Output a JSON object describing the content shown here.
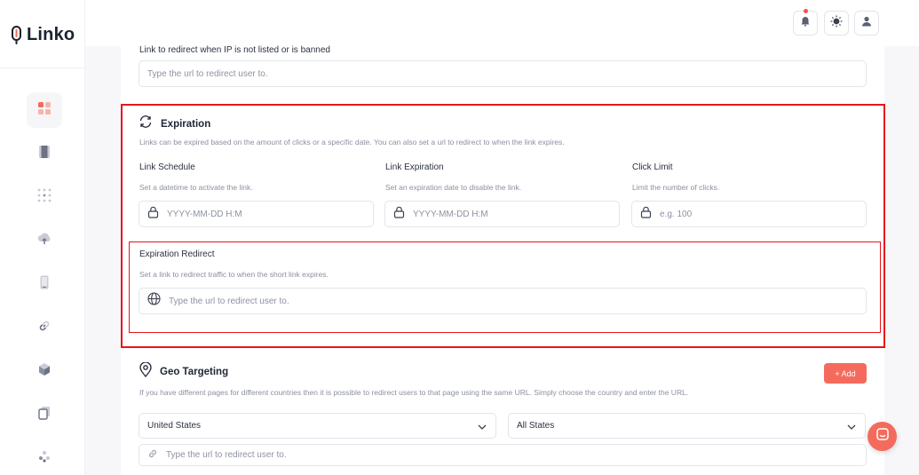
{
  "app": {
    "brand": "Linko"
  },
  "topbar": {
    "notification_icon": "bell-icon",
    "theme_icon": "sun-icon",
    "profile_icon": "user-icon"
  },
  "sidebar": {
    "items": [
      {
        "icon": "dashboard-grid-icon",
        "active": true
      },
      {
        "icon": "barcode-icon",
        "active": false
      },
      {
        "icon": "dots-grid-icon",
        "active": false
      },
      {
        "icon": "cloud-upload-icon",
        "active": false
      },
      {
        "icon": "mobile-icon",
        "active": false
      },
      {
        "icon": "link-icon",
        "active": false
      },
      {
        "icon": "cube-icon",
        "active": false
      },
      {
        "icon": "copy-icon",
        "active": false
      },
      {
        "icon": "integrations-icon",
        "active": false
      }
    ]
  },
  "ip_redirect": {
    "label": "Link to redirect when IP is not listed or is banned",
    "placeholder": "Type the url to redirect user to."
  },
  "expiration": {
    "title": "Expiration",
    "description": "Links can be expired based on the amount of clicks or a specific date. You can also set a url to redirect to when the link expires.",
    "schedule": {
      "label": "Link Schedule",
      "help": "Set a datetime to activate the link.",
      "placeholder": "YYYY-MM-DD H:M"
    },
    "link_expiration": {
      "label": "Link Expiration",
      "help": "Set an expiration date to disable the link.",
      "placeholder": "YYYY-MM-DD H:M"
    },
    "click_limit": {
      "label": "Click Limit",
      "help": "Limit the number of clicks.",
      "placeholder": "e.g. 100"
    },
    "redirect": {
      "label": "Expiration Redirect",
      "help": "Set a link to redirect traffic to when the short link expires.",
      "placeholder": "Type the url to redirect user to."
    }
  },
  "geo": {
    "title": "Geo Targeting",
    "add_label": "+ Add",
    "description": "If you have different pages for different countries then it is possible to redirect users to that page using the same URL. Simply choose the country and enter the URL.",
    "country": "United States",
    "state": "All States",
    "url_placeholder": "Type the url to redirect user to."
  },
  "colors": {
    "accent": "#f46b5d",
    "highlight": "#e8141c"
  }
}
